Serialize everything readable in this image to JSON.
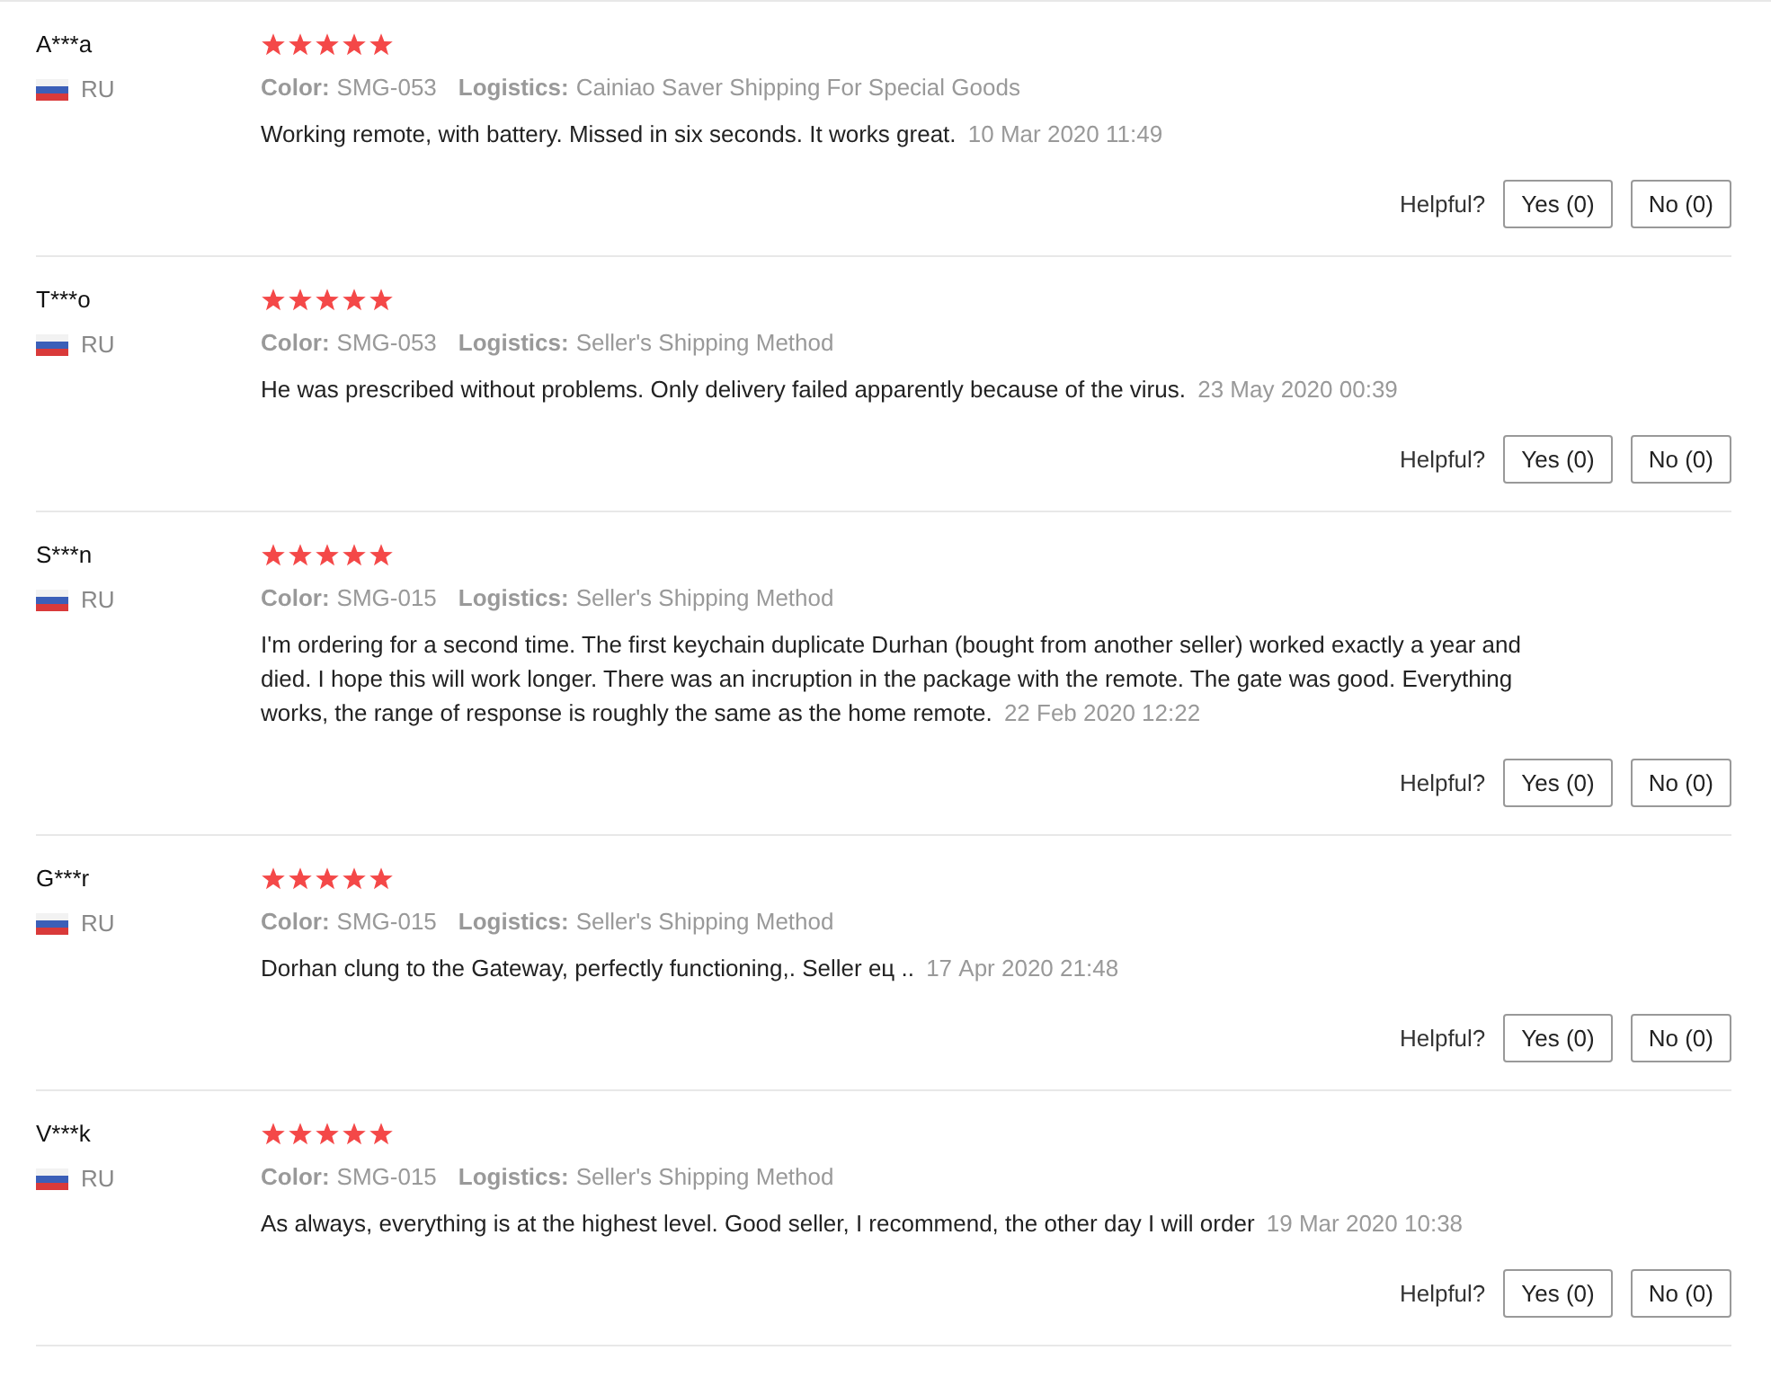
{
  "reviews": [
    {
      "name": "A***a",
      "country": "RU",
      "stars": 5,
      "color_label": "Color:",
      "variant": "SMG-053",
      "logistics_label": "Logistics:",
      "logistics": "Cainiao Saver Shipping For Special Goods",
      "text": "Working remote, with battery. Missed in six seconds. It works great.",
      "date": "10 Mar 2020 11:49",
      "helpful": "Helpful?",
      "yes": "Yes (0)",
      "no": "No (0)"
    },
    {
      "name": "T***o",
      "country": "RU",
      "stars": 5,
      "color_label": "Color:",
      "variant": "SMG-053",
      "logistics_label": "Logistics:",
      "logistics": "Seller's Shipping Method",
      "text": "He was prescribed without problems. Only delivery failed apparently because of the virus.",
      "date": "23 May 2020 00:39",
      "helpful": "Helpful?",
      "yes": "Yes (0)",
      "no": "No (0)"
    },
    {
      "name": "S***n",
      "country": "RU",
      "stars": 5,
      "color_label": "Color:",
      "variant": "SMG-015",
      "logistics_label": "Logistics:",
      "logistics": "Seller's Shipping Method",
      "text": "I'm ordering for a second time. The first keychain duplicate Durhan (bought from another seller) worked exactly a year and died. I hope this will work longer. There was an incruption in the package with the remote. The gate was good. Everything works, the range of response is roughly the same as the home remote.",
      "date": "22 Feb 2020 12:22",
      "helpful": "Helpful?",
      "yes": "Yes (0)",
      "no": "No (0)"
    },
    {
      "name": "G***r",
      "country": "RU",
      "stars": 5,
      "color_label": "Color:",
      "variant": "SMG-015",
      "logistics_label": "Logistics:",
      "logistics": "Seller's Shipping Method",
      "text": "Dorhan clung to the Gateway, perfectly functioning,. Seller ец ..",
      "date": "17 Apr 2020 21:48",
      "helpful": "Helpful?",
      "yes": "Yes (0)",
      "no": "No (0)"
    },
    {
      "name": "V***k",
      "country": "RU",
      "stars": 5,
      "color_label": "Color:",
      "variant": "SMG-015",
      "logistics_label": "Logistics:",
      "logistics": "Seller's Shipping Method",
      "text": "As always, everything is at the highest level. Good seller, I recommend, the other day I will order",
      "date": "19 Mar 2020 10:38",
      "helpful": "Helpful?",
      "yes": "Yes (0)",
      "no": "No (0)"
    }
  ]
}
